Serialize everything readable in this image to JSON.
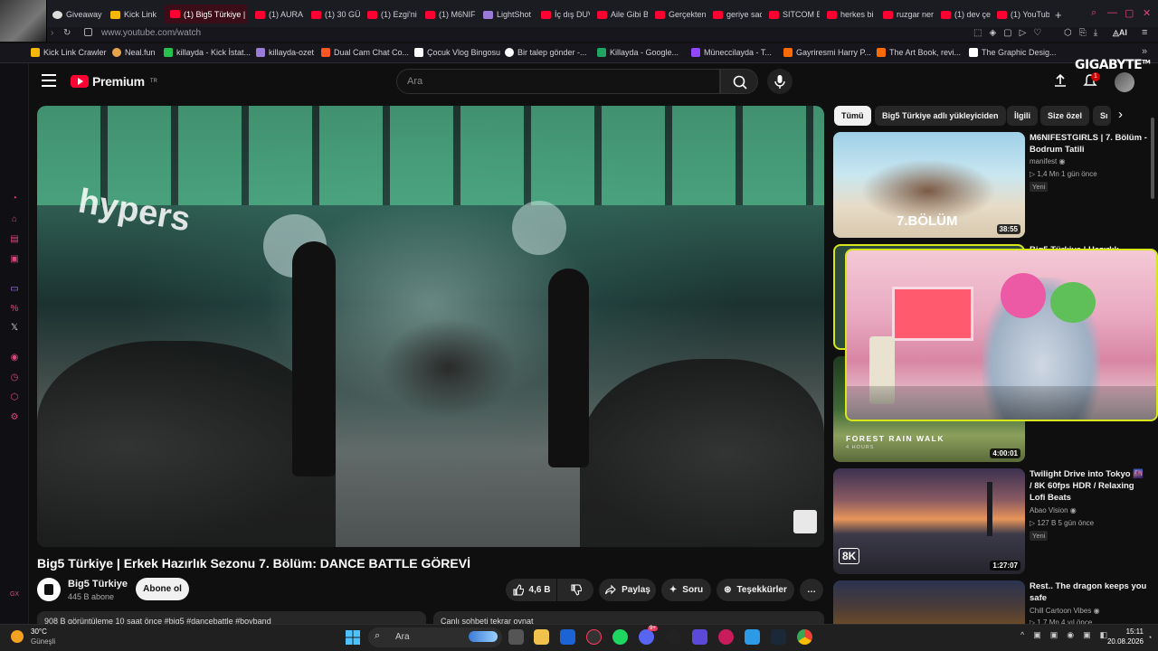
{
  "browser": {
    "tabs": [
      {
        "label": "Giveaway",
        "active": false
      },
      {
        "label": "Kick Link",
        "active": false
      },
      {
        "label": "(1) Big5 Türkiye | E",
        "active": true
      },
      {
        "label": "(1) AURA",
        "active": false
      },
      {
        "label": "(1) 30 GÜ",
        "active": false
      },
      {
        "label": "(1) Ezgi'ni",
        "active": false
      },
      {
        "label": "(1) M6NIF",
        "active": false
      },
      {
        "label": "LightShot",
        "active": false
      },
      {
        "label": "İç dış DUV",
        "active": false
      },
      {
        "label": "Aile Gibi B",
        "active": false
      },
      {
        "label": "Gerçekten",
        "active": false
      },
      {
        "label": "geriye sad",
        "active": false
      },
      {
        "label": "SITCOM E",
        "active": false
      },
      {
        "label": "herkes bi",
        "active": false
      },
      {
        "label": "ruzgar ner",
        "active": false
      },
      {
        "label": "(1) dev çe",
        "active": false
      },
      {
        "label": "(1) YouTub",
        "active": false
      }
    ],
    "new_tab": "+",
    "url": "www.youtube.com/watch",
    "bookmarks": [
      {
        "label": "Kick Link Crawler",
        "color": "#f5b800"
      },
      {
        "label": "Neal.fun",
        "color": "#e8a54b"
      },
      {
        "label": "killayda - Kick İstat...",
        "color": "#27c24c"
      },
      {
        "label": "killayda-ozet",
        "color": "#9b7bd8"
      },
      {
        "label": "Dual Cam Chat Co...",
        "color": "#ff5722"
      },
      {
        "label": "Çocuk Vlog Bingosu",
        "color": "#ffffff"
      },
      {
        "label": "Bir talep gönder -...",
        "color": "#ffffff"
      },
      {
        "label": "Killayda - Google...",
        "color": "#1fa463"
      },
      {
        "label": "Müneccilayda - T...",
        "color": "#9146ff"
      },
      {
        "label": "Gayriresmi Harry P...",
        "color": "#ff6b00"
      },
      {
        "label": "The Art Book, revi...",
        "color": "#ff6b00"
      },
      {
        "label": "The Graphic Desig...",
        "color": "#ffffff"
      }
    ],
    "overlay_brand": "GIGABYTE",
    "overlay_brand_tm": "TM"
  },
  "youtube": {
    "logo_text": "Premium",
    "logo_region": "TR",
    "search_placeholder": "Ara",
    "notifications_count": "1",
    "video": {
      "overlay_text": "hypers",
      "title": "Big5 Türkiye | Erkek Hazırlık Sezonu 7. Bölüm: DANCE BATTLE GÖREVİ",
      "channel": "Big5 Türkiye",
      "subscribers": "445 B abone",
      "subscribe_label": "Abone ol",
      "likes": "4,6 B",
      "share_label": "Paylaş",
      "ask_label": "Soru",
      "thanks_label": "Teşekkürler",
      "more": "…",
      "description_preview": "908 B görüntüleme  10 saat önce  #big5 #dancebattle #boyband",
      "comments_preview": "Canlı sohbeti tekrar oynat"
    },
    "chips": [
      "Tümü",
      "Big5 Türkiye adlı yükleyiciden",
      "İlgili",
      "Size özel",
      "Sı"
    ],
    "recommendations": [
      {
        "title": "M6NIFESTGIRLS | 7. Bölüm - Bodrum Tatili",
        "channel": "manifest",
        "meta": "▷ 1,4 Mn  1 gün önce",
        "badge": "Yeni",
        "duration": "38:55",
        "thumb_text": "7.BÖLÜM"
      },
      {
        "title": "Big5 Türkiye | Hazırlık",
        "channel": "",
        "meta": "",
        "badge": "",
        "duration": "",
        "thumb_text": ""
      },
      {
        "title": "",
        "channel": "",
        "meta": "",
        "badge": "",
        "duration": "4:00:01",
        "thumb_text": "FOREST RAIN WALK",
        "thumb_sub": "4 HOURS"
      },
      {
        "title": "Twilight Drive into Tokyo 🌆 / 8K 60fps HDR / Relaxing Lofi Beats",
        "channel": "Abao Vision",
        "meta": "▷ 127 B  5 gün önce",
        "badge": "Yeni",
        "duration": "1:27:07",
        "thumb_text": "8K"
      },
      {
        "title": "Rest.. The dragon keeps you safe",
        "channel": "Chill Cartoon Vibes",
        "meta": "▷ 1,7 Mn  4 yıl önce",
        "badge": "",
        "duration": "",
        "thumb_text": ""
      }
    ]
  },
  "taskbar": {
    "weather_temp": "30°C",
    "weather_desc": "Güneşli",
    "search_placeholder": "Ara",
    "time": "15:11",
    "date": "20.08.2026",
    "discord_badge": "9+"
  },
  "colors": {
    "yt_red": "#ff0033",
    "accent_pink": "#e0467a",
    "webcam_border": "#d7e61a"
  }
}
